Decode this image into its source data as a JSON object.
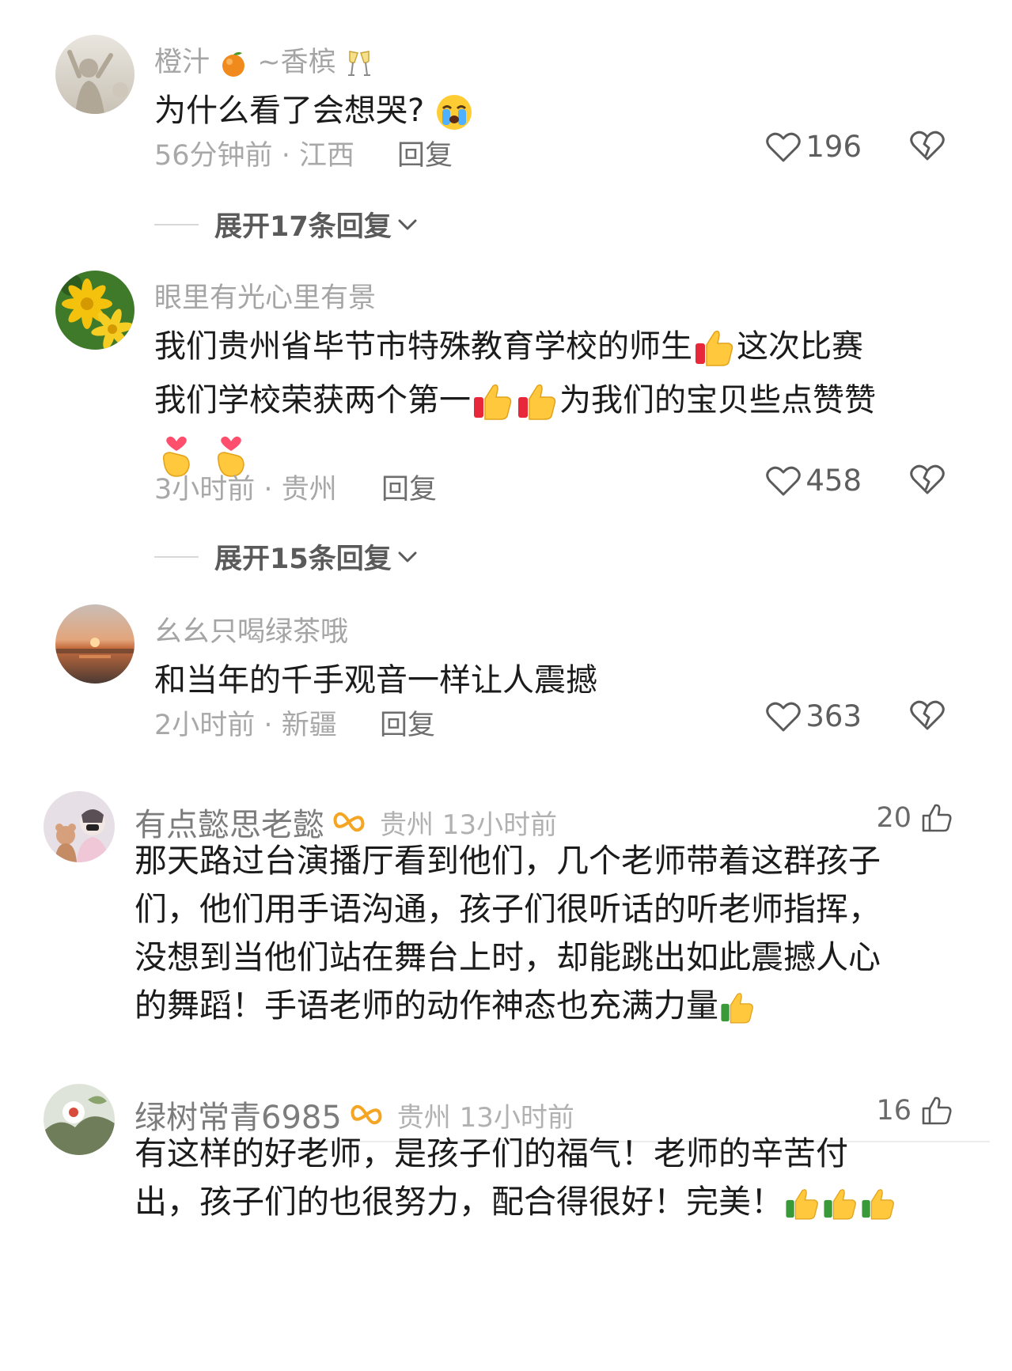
{
  "comments": [
    {
      "username": "橙汁",
      "username_suffix": "~香槟",
      "text": "为什么看了会想哭?",
      "time": "56分钟前",
      "location": "江西",
      "reply_label": "回复",
      "likes": "196",
      "expand_label": "展开17条回复"
    },
    {
      "username": "眼里有光心里有景",
      "text_line1": "我们贵州省毕节市特殊教育学校的师生",
      "text_line1_end": "这次比赛",
      "text_line2": "我们学校荣获两个第一",
      "text_line2_end": "为我们的宝贝些点赞赞",
      "time": "3小时前",
      "location": "贵州",
      "reply_label": "回复",
      "likes": "458",
      "expand_label": "展开15条回复"
    },
    {
      "username": "幺幺只喝绿茶哦",
      "text": "和当年的千手观音一样让人震撼",
      "time": "2小时前",
      "location": "新疆",
      "reply_label": "回复",
      "likes": "363"
    },
    {
      "username": "有点懿思老懿",
      "location_time": "贵州 13小时前",
      "likes": "20",
      "lines": [
        "那天路过台演播厅看到他们，几个老师带着这群孩子",
        "们，他们用手语沟通，孩子们很听话的听老师指挥，",
        "没想到当他们站在舞台上时，却能跳出如此震撼人心",
        "的舞蹈！手语老师的动作神态也充满力量"
      ]
    },
    {
      "username": "绿树常青6985",
      "location_time": "贵州 13小时前",
      "likes": "16",
      "lines": [
        "有这样的好老师，是孩子们的福气！老师的辛苦付",
        "出，孩子们的也很努力，配合得很好！完美！"
      ]
    }
  ],
  "meta_separator": "·",
  "icons": {
    "like": "heart-outline-icon",
    "dislike": "broken-heart-icon",
    "expand": "chevron-down-icon",
    "thumb": "thumbs-up-outline-icon",
    "badge": "infinity-badge-icon"
  }
}
